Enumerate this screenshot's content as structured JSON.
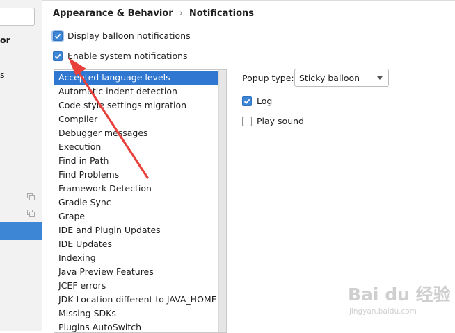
{
  "breadcrumb": {
    "parent": "Appearance & Behavior",
    "separator": "›",
    "current": "Notifications"
  },
  "sidebar": {
    "visible_text_bold": "or",
    "visible_text_small": "s"
  },
  "options": {
    "display_balloon": {
      "label": "Display balloon notifications",
      "checked": true
    },
    "enable_system": {
      "label": "Enable system notifications",
      "checked": true
    }
  },
  "groups": {
    "selected_index": 0,
    "items": [
      "Accepted language levels",
      "Automatic indent detection",
      "Code style settings migration",
      "Compiler",
      "Debugger messages",
      "Execution",
      "Find in Path",
      "Find Problems",
      "Framework Detection",
      "Gradle Sync",
      "Grape",
      "IDE and Plugin Updates",
      "IDE Updates",
      "Indexing",
      "Java Preview Features",
      "JCEF errors",
      "JDK Location different to JAVA_HOME",
      "Missing SDKs",
      "Plugins AutoSwitch"
    ]
  },
  "group_settings": {
    "popup_type_label": "Popup type:",
    "popup_type_value": "Sticky balloon",
    "log": {
      "label": "Log",
      "checked": true
    },
    "play_sound": {
      "label": "Play sound",
      "checked": false
    }
  },
  "watermark": {
    "brand": "Bai du 经验",
    "url": "jingyan.baidu.com"
  },
  "colors": {
    "accent": "#3d86d6",
    "selection": "#2f77d1",
    "annotation_arrow": "#e8403a"
  },
  "icons": {
    "check": "checkmark-icon",
    "dropdown": "chevron-down-icon",
    "copy": "copy-icon"
  }
}
